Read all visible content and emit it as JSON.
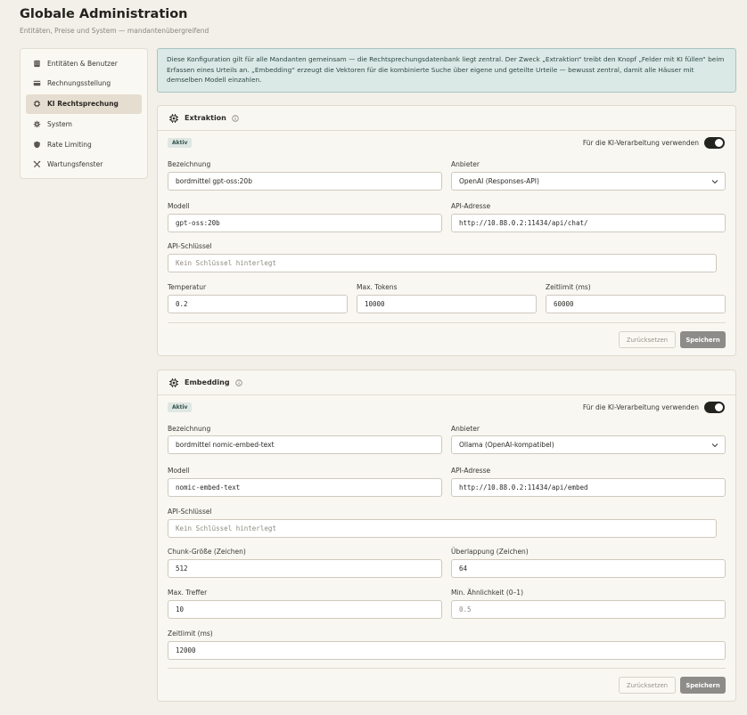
{
  "header": {
    "title": "Globale Administration",
    "subtitle": "Entitäten, Preise und System — mandantenübergreifend"
  },
  "sidebar": {
    "items": [
      {
        "label": "Entitäten & Benutzer",
        "icon": "building-icon"
      },
      {
        "label": "Rechnungsstellung",
        "icon": "card-icon"
      },
      {
        "label": "KI Rechtsprechung",
        "icon": "chip-icon",
        "active": true
      },
      {
        "label": "System",
        "icon": "gear-icon"
      },
      {
        "label": "Rate Limiting",
        "icon": "shield-icon"
      },
      {
        "label": "Wartungsfenster",
        "icon": "tools-icon"
      }
    ]
  },
  "info": {
    "text": "Diese Konfiguration gilt für alle Mandanten gemeinsam — die Rechtsprechungsdatenbank liegt zentral. Der Zweck „Extraktion“ treibt den Knopf „Felder mit KI füllen“ beim Erfassen eines Urteils an. „Embedding“ erzeugt die Vektoren für die kombinierte Suche über eigene und geteilte Urteile — bewusst zentral, damit alle Häuser mit demselben Modell einzahlen."
  },
  "extraktion": {
    "title": "Extraktion",
    "badge": "Aktiv",
    "toggle_label": "Für die KI-Verarbeitung verwenden",
    "toggle_on": true,
    "bezeichnung_label": "Bezeichnung",
    "bezeichnung": "bordmittel gpt-oss:20b",
    "anbieter_label": "Anbieter",
    "anbieter": "OpenAI (Responses-API)",
    "modell_label": "Modell",
    "modell": "gpt-oss:20b",
    "api_adresse_label": "API-Adresse",
    "api_adresse": "http://10.88.0.2:11434/api/chat/",
    "api_schluessel_label": "API-Schlüssel",
    "api_schluessel_placeholder": "Kein Schlüssel hinterlegt",
    "temperatur_label": "Temperatur",
    "temperatur": "0.2",
    "max_tokens_label": "Max. Tokens",
    "max_tokens": "10000",
    "zeitlimit_label": "Zeitlimit (ms)",
    "zeitlimit": "60000",
    "reset_label": "Zurücksetzen",
    "save_label": "Speichern"
  },
  "embedding": {
    "title": "Embedding",
    "badge": "Aktiv",
    "toggle_label": "Für die KI-Verarbeitung verwenden",
    "toggle_on": true,
    "bezeichnung_label": "Bezeichnung",
    "bezeichnung": "bordmittel nomic-embed-text",
    "anbieter_label": "Anbieter",
    "anbieter": "Ollama (OpenAI-kompatibel)",
    "modell_label": "Modell",
    "modell": "nomic-embed-text",
    "api_adresse_label": "API-Adresse",
    "api_adresse": "http://10.88.0.2:11434/api/embed",
    "api_schluessel_label": "API-Schlüssel",
    "api_schluessel_placeholder": "Kein Schlüssel hinterlegt",
    "chunk_label": "Chunk-Größe (Zeichen)",
    "chunk": "512",
    "overlap_label": "Überlappung (Zeichen)",
    "overlap": "64",
    "max_treffer_label": "Max. Treffer",
    "max_treffer": "10",
    "min_aehnlichkeit_label": "Min. Ähnlichkeit (0–1)",
    "min_aehnlichkeit_placeholder": "0.5",
    "zeitlimit_label": "Zeitlimit (ms)",
    "zeitlimit": "12000",
    "reset_label": "Zurücksetzen",
    "save_label": "Speichern"
  }
}
